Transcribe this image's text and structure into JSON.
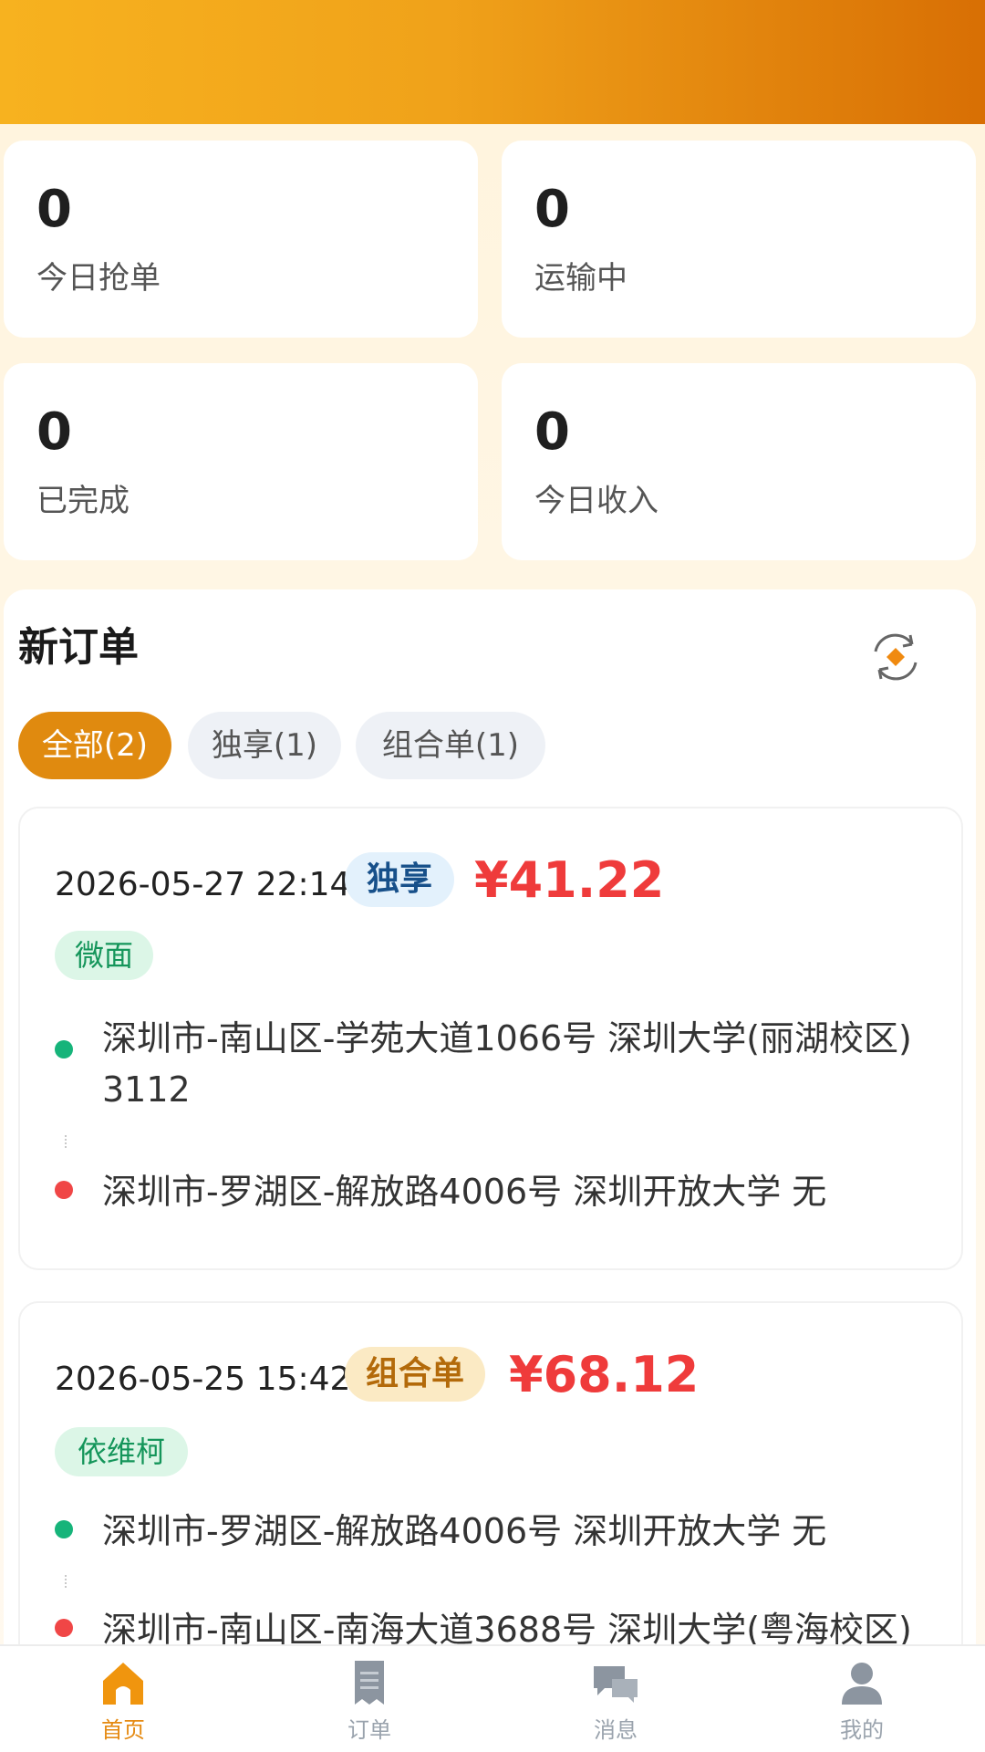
{
  "stats": [
    {
      "value": "0",
      "label": "今日抢单"
    },
    {
      "value": "0",
      "label": "运输中"
    },
    {
      "value": "0",
      "label": "已完成"
    },
    {
      "value": "0",
      "label": "今日收入"
    }
  ],
  "orders_section": {
    "title": "新订单",
    "refresh_icon": "refresh-location-icon",
    "filters": [
      {
        "label": "全部(2)",
        "active": true
      },
      {
        "label": "独享(1)",
        "active": false
      },
      {
        "label": "组合单(1)",
        "active": false
      }
    ]
  },
  "orders": [
    {
      "time": "2026-05-27 22:14",
      "type": "独享",
      "price": "¥41.22",
      "shop": "微面",
      "pickup": "深圳市-南山区-学苑大道1066号 深圳大学(丽湖校区) 3112",
      "dropoff": "深圳市-罗湖区-解放路4006号 深圳开放大学 无"
    },
    {
      "time": "2026-05-25 15:42",
      "type": "组合单",
      "price": "¥68.12",
      "shop": "依维柯",
      "pickup": "深圳市-罗湖区-解放路4006号 深圳开放大学 无",
      "dropoff": "深圳市-南山区-南海大道3688号 深圳大学(粤海校区)"
    }
  ],
  "tabbar": [
    {
      "label": "首页",
      "icon": "home-icon",
      "active": true
    },
    {
      "label": "订单",
      "icon": "order-list-icon",
      "active": false
    },
    {
      "label": "消息",
      "icon": "message-icon",
      "active": false
    },
    {
      "label": "我的",
      "icon": "user-icon",
      "active": false
    }
  ],
  "colors": {
    "accent": "#e08a0f",
    "price": "#ef3b3b",
    "tab_active": "#e58a12",
    "tab_inactive": "#9aa3ad"
  }
}
